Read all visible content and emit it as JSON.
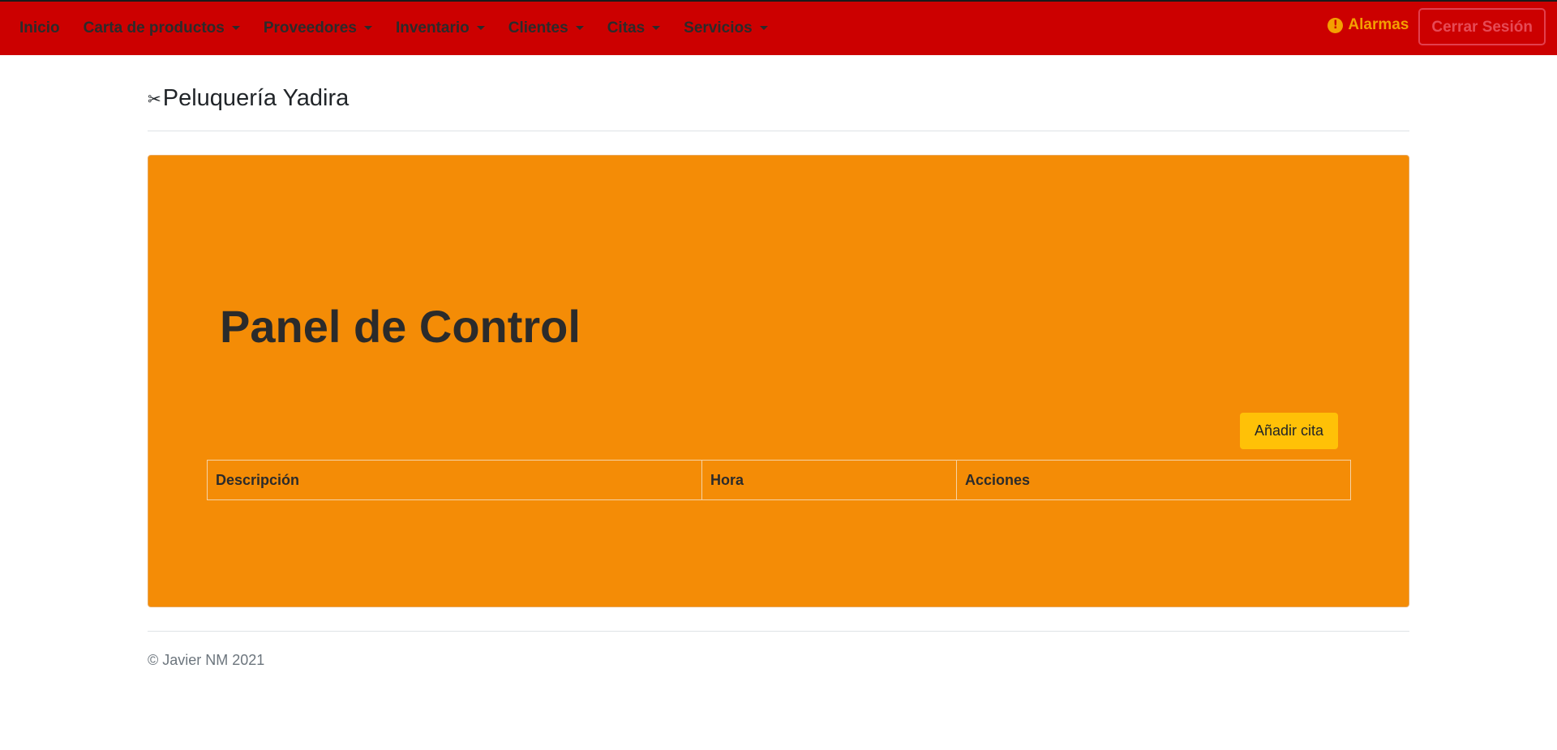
{
  "nav": {
    "items": [
      {
        "label": "Inicio",
        "dropdown": false
      },
      {
        "label": "Carta de productos",
        "dropdown": true
      },
      {
        "label": "Proveedores",
        "dropdown": true
      },
      {
        "label": "Inventario",
        "dropdown": true
      },
      {
        "label": "Clientes",
        "dropdown": true
      },
      {
        "label": "Citas",
        "dropdown": true
      },
      {
        "label": "Servicios",
        "dropdown": true
      }
    ],
    "alarm_label": "Alarmas",
    "alarm_icon": "exclamation-circle-icon",
    "logout_label": "Cerrar Sesión"
  },
  "brand": {
    "icon": "scissors-icon",
    "glyph": "✂",
    "name": "Peluquería Yadira"
  },
  "panel": {
    "title": "Panel de Control",
    "add_button": "Añadir cita",
    "table": {
      "headers": [
        "Descripción",
        "Hora",
        "Acciones"
      ],
      "rows": []
    }
  },
  "footer": {
    "text": "© Javier NM 2021"
  },
  "colors": {
    "navbar": "#cc0000",
    "panel": "#f48c06",
    "alarm": "#f4a000",
    "add_button": "#ffc107",
    "logout_border": "#e2404e"
  }
}
